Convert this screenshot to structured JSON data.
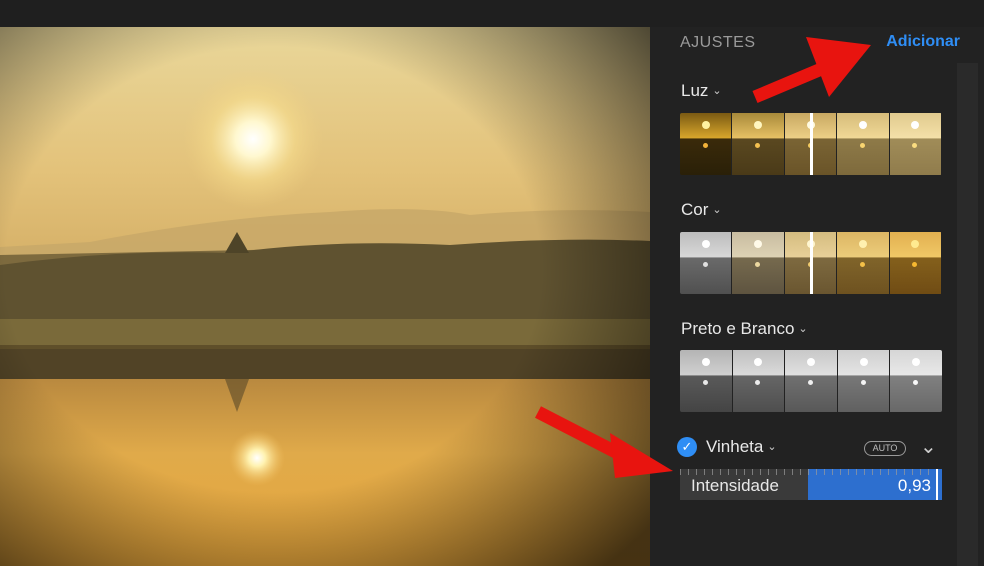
{
  "panel": {
    "title": "AJUSTES",
    "add_label": "Adicionar"
  },
  "sections": [
    {
      "label": "Luz",
      "chevron": "chevron-down-icon"
    },
    {
      "label": "Cor",
      "chevron": "chevron-down-icon"
    },
    {
      "label": "Preto e Branco",
      "chevron": "chevron-down-icon"
    }
  ],
  "vignette": {
    "label": "Vinheta",
    "checked": true,
    "auto_label": "AUTO",
    "slider_label": "Intensidade",
    "slider_value": "0,93",
    "slider_fraction": 0.93
  },
  "colors": {
    "accent": "#2f8ef5",
    "slider_fill": "#2d6fcf",
    "annotation_arrow": "#e8140f"
  }
}
